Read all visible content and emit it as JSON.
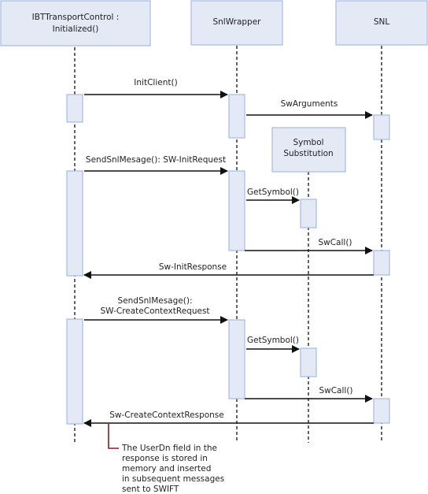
{
  "participants": [
    {
      "id": "ibt",
      "lines": [
        "IBTTransportControl :",
        "Initialized()"
      ]
    },
    {
      "id": "snlwrapper",
      "lines": [
        "SnlWrapper"
      ]
    },
    {
      "id": "snl",
      "lines": [
        "SNL"
      ]
    },
    {
      "id": "symbol",
      "lines": [
        "Symbol",
        "Substitution"
      ]
    }
  ],
  "messages": [
    {
      "id": "initclient",
      "lines": [
        "InitClient()"
      ]
    },
    {
      "id": "swarguments",
      "lines": [
        "SwArguments"
      ]
    },
    {
      "id": "sendsnl-init",
      "lines": [
        "SendSnlMesage(): SW-InitRequest"
      ]
    },
    {
      "id": "getsymbol-1",
      "lines": [
        "GetSymbol()"
      ]
    },
    {
      "id": "swcall-1",
      "lines": [
        "SwCall()"
      ]
    },
    {
      "id": "initresponse",
      "lines": [
        "Sw-InitResponse"
      ]
    },
    {
      "id": "sendsnl-ctx",
      "lines": [
        "SendSnlMesage():",
        "SW-CreateContextRequest"
      ]
    },
    {
      "id": "getsymbol-2",
      "lines": [
        "GetSymbol()"
      ]
    },
    {
      "id": "swcall-2",
      "lines": [
        "SwCall()"
      ]
    },
    {
      "id": "ctxresponse",
      "lines": [
        "Sw-CreateContextResponse"
      ]
    }
  ],
  "note": {
    "lines": [
      "The UserDn field in the",
      "response is stored in",
      "memory and inserted",
      "in subsequent messages",
      "sent to SWIFT"
    ]
  }
}
